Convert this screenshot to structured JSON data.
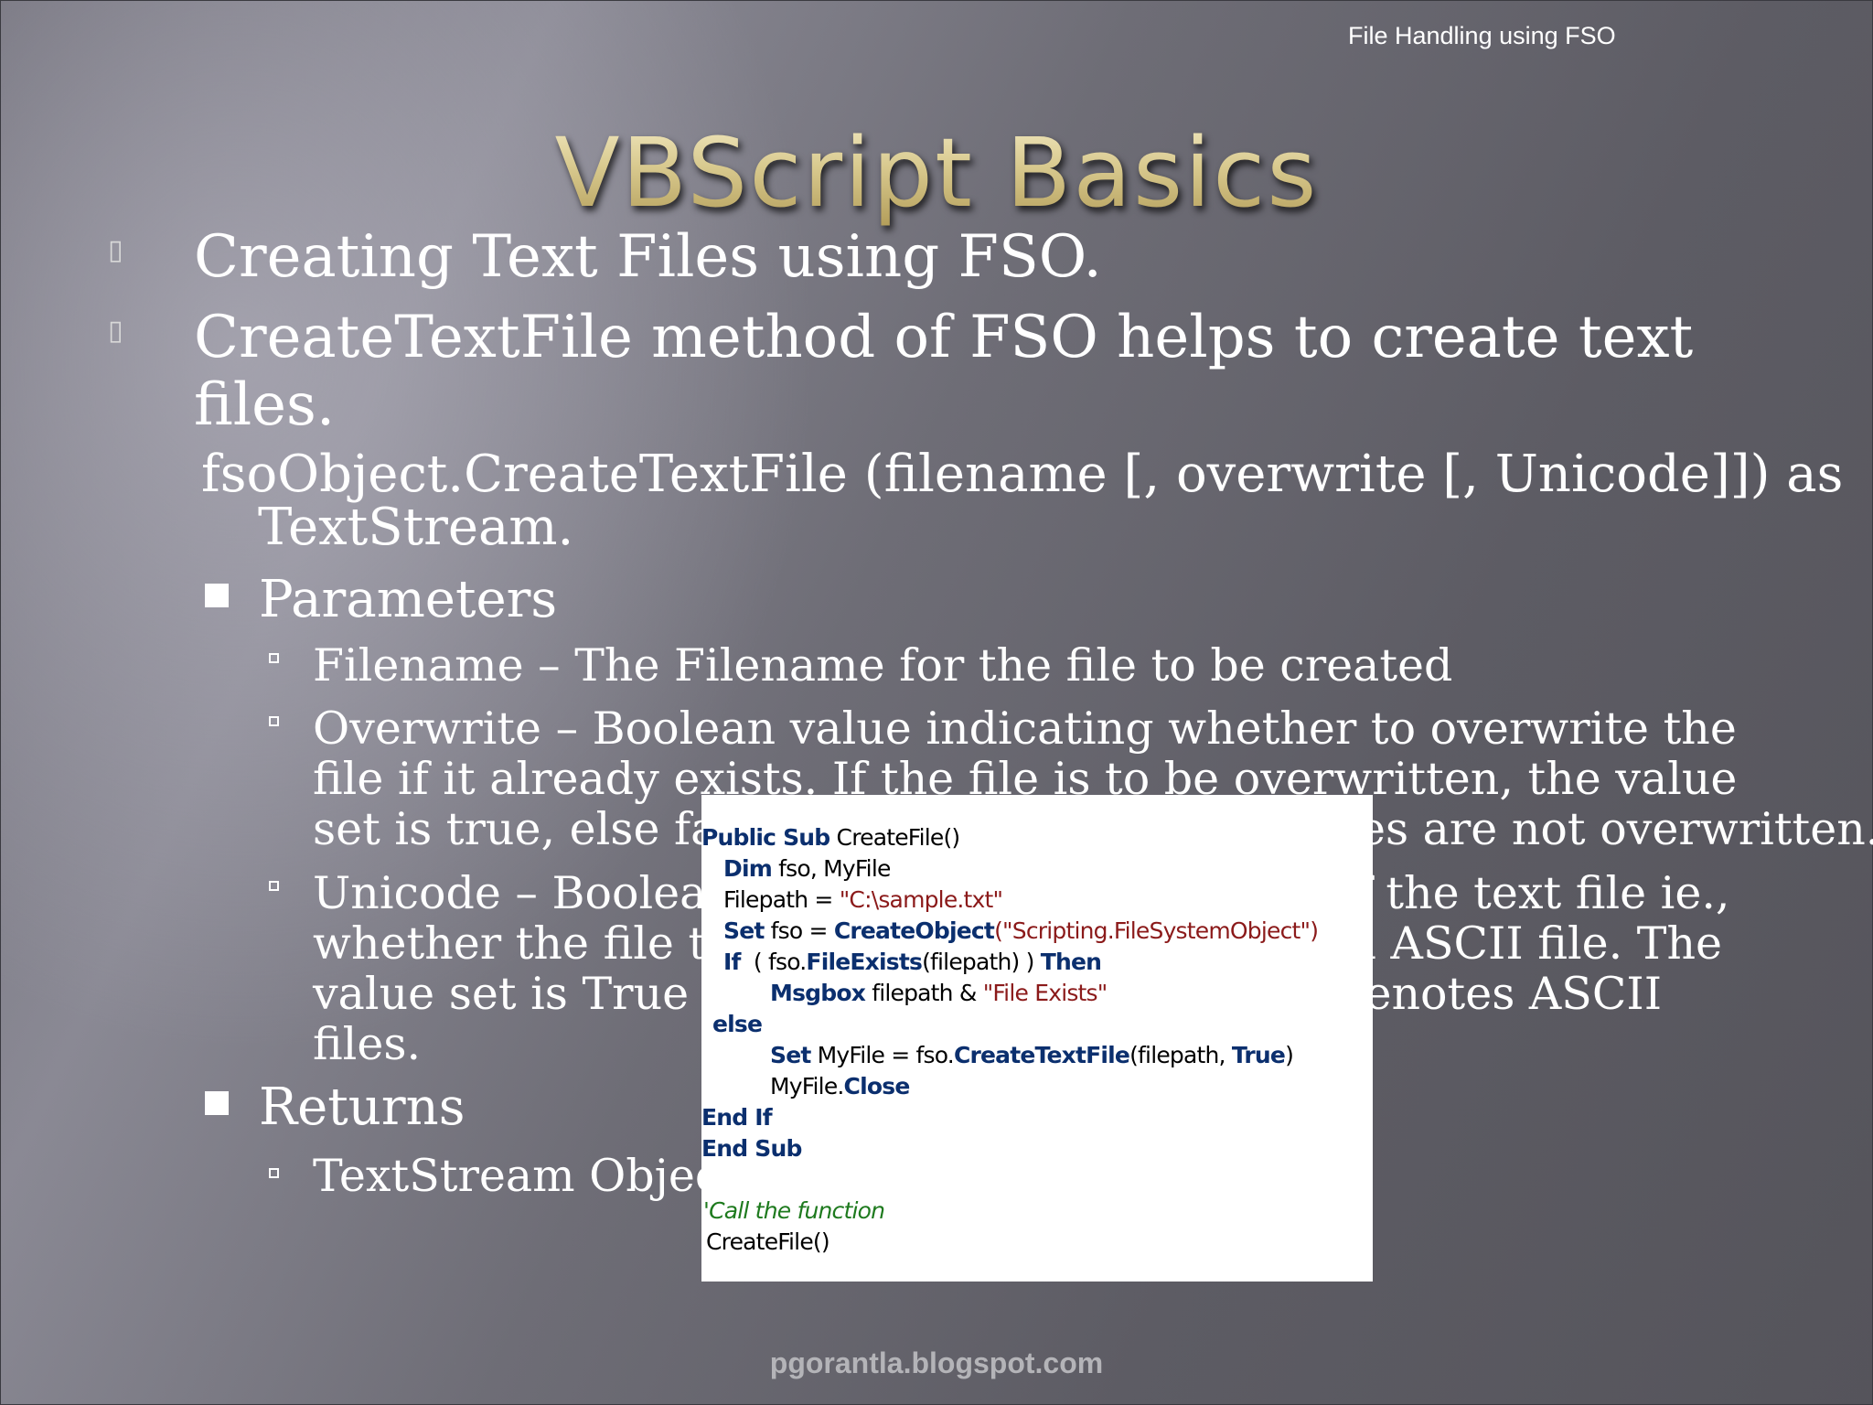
{
  "header": {
    "topic": "File Handling using FSO"
  },
  "slide": {
    "title": "VBScript Basics",
    "bullets": [
      "Creating Text Files using FSO.",
      "CreateTextFile method of FSO helps to create text",
      "files."
    ],
    "syntax_line1": "fsoObject.CreateTextFile (filename [, overwrite [, Unicode]]) as",
    "syntax_line2": "TextStream.",
    "parameters_label": "Parameters",
    "filename_item": "Filename – The Filename for the file to be created",
    "overwrite_lines": [
      "Overwrite – Boolean value indicating whether to overwrite the",
      "file if it already exists. If the file is to be overwritten, the value",
      "set is true, else false, which means that the files are not overwritten."
    ],
    "unicode_lines": [
      "Unicode – Boolean value indicating the type of the text file ie.,",
      "whether the file to be created is Unicode or an ASCII file.  The",
      "value set is True for Unicode, and False that denotes ASCII",
      "files."
    ],
    "returns_label": "Returns",
    "returns_item": "TextStream Object"
  },
  "code": {
    "line1_kw": "Public Sub",
    "line1_rest": " CreateFile()",
    "line2_kw": "Dim",
    "line2_rest": " fso, MyFile",
    "line3_plain": "Filepath = ",
    "line3_str": "\"C:\\sample.txt\"",
    "line4_kw": "Set",
    "line4_plain": " fso = ",
    "line4_kw2": "CreateObject",
    "line4_str": "(\"Scripting.FileSystemObject\")",
    "line5_kw": "If",
    "line5_plain": "  ( fso.",
    "line5_kw2": "FileExists",
    "line5_plain2": "(filepath) ) ",
    "line5_kw3": "Then",
    "line6_kw": "Msgbox",
    "line6_plain": " filepath & ",
    "line6_str": "\"File Exists\"",
    "line7_kw": "else",
    "line8_kw": "Set",
    "line8_plain": " MyFile = fso.",
    "line8_kw2": "CreateTextFile",
    "line8_plain2": "(filepath, ",
    "line8_kw3": "True",
    "line8_plain3": ")",
    "line9_plain": "MyFile.",
    "line9_kw": "Close",
    "line10_kw": "End If",
    "line11_kw": "End Sub",
    "line12_cmt": "'Call the function",
    "line13_plain": "CreateFile()"
  },
  "footer": {
    "site": "pgorantla.blogspot.com"
  },
  "colors": {
    "title_gold": "#dcd0a0",
    "code_keyword": "#0b2f6e",
    "code_string": "#8b1a1a",
    "code_comment": "#1e7a1e"
  }
}
